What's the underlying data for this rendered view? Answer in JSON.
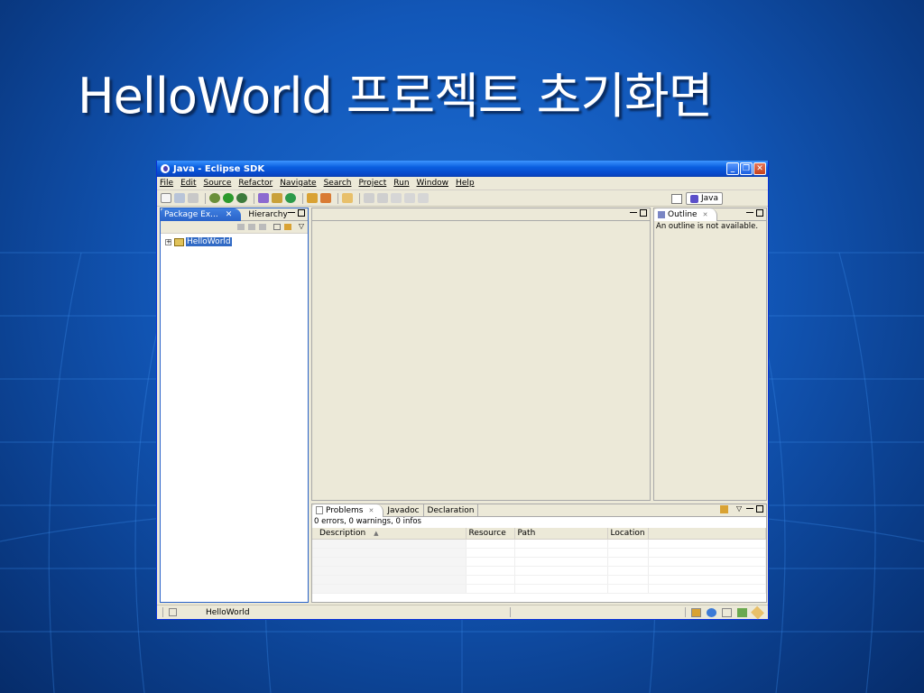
{
  "slide": {
    "title": "HelloWorld 프로젝트 초기화면"
  },
  "window": {
    "title": "Java - Eclipse SDK",
    "minimize": "_",
    "restore": "❐",
    "close": "✕"
  },
  "menu": [
    "File",
    "Edit",
    "Source",
    "Refactor",
    "Navigate",
    "Search",
    "Project",
    "Run",
    "Window",
    "Help"
  ],
  "perspective": {
    "label": "Java"
  },
  "package_explorer": {
    "tab_label": "Package Ex...",
    "tab_close": "✕",
    "hierarchy_label": "Hierarchy",
    "project": "HelloWorld",
    "expand": "+"
  },
  "outline": {
    "tab_label": "Outline",
    "tab_close": "✕",
    "message": "An outline is not available."
  },
  "problems": {
    "tabs": [
      "Problems",
      "Javadoc",
      "Declaration"
    ],
    "tab_close": "✕",
    "summary": "0 errors, 0 warnings, 0 infos",
    "columns": [
      "Description",
      "Resource",
      "Path",
      "Location"
    ],
    "sort_indicator": "▲"
  },
  "status_bar": {
    "text": "HelloWorld"
  },
  "colors": {
    "active_tab": "#2a63c9",
    "title_bar": "#0a5fe0",
    "selection": "#316ac5",
    "slide_bg": "#1257b8"
  }
}
